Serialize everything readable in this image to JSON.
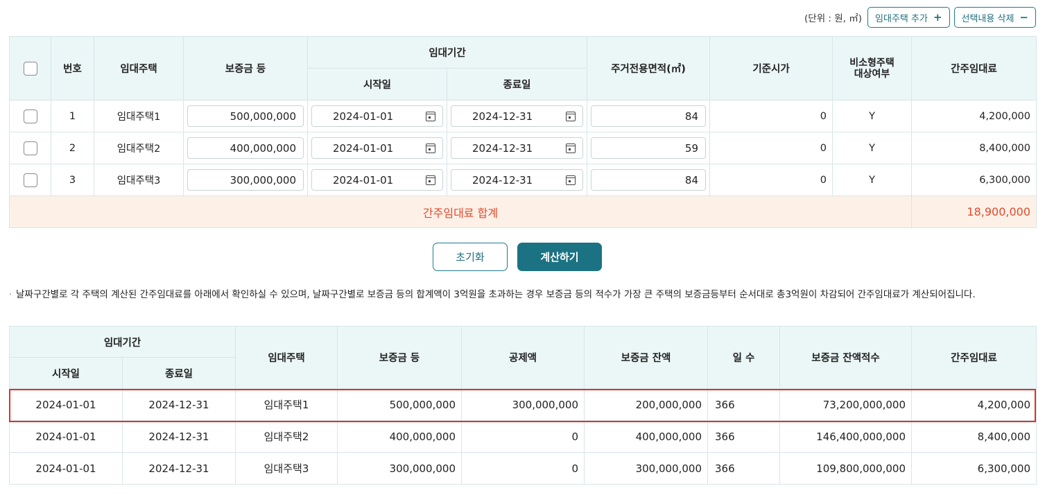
{
  "top": {
    "unit": "(단위 : 원, ㎡)",
    "add_button": "임대주택 추가",
    "add_symbol": "+",
    "delete_button": "선택내용 삭제",
    "delete_symbol": "−"
  },
  "table1": {
    "headers": {
      "number": "번호",
      "house": "임대주택",
      "deposit": "보증금 등",
      "period": "임대기간",
      "start": "시작일",
      "end": "종료일",
      "area": "주거전용면적(㎡)",
      "price": "기준시가",
      "small": "비소형주택\n대상여부",
      "rent": "간주임대료"
    },
    "rows": [
      {
        "no": "1",
        "house": "임대주택1",
        "deposit": "500,000,000",
        "start": "2024-01-01",
        "end": "2024-12-31",
        "area": "84",
        "price": "0",
        "small": "Y",
        "rent": "4,200,000"
      },
      {
        "no": "2",
        "house": "임대주택2",
        "deposit": "400,000,000",
        "start": "2024-01-01",
        "end": "2024-12-31",
        "area": "59",
        "price": "0",
        "small": "Y",
        "rent": "8,400,000"
      },
      {
        "no": "3",
        "house": "임대주택3",
        "deposit": "300,000,000",
        "start": "2024-01-01",
        "end": "2024-12-31",
        "area": "84",
        "price": "0",
        "small": "Y",
        "rent": "6,300,000"
      }
    ],
    "sum_label": "간주임대료 합계",
    "sum_value": "18,900,000"
  },
  "buttons": {
    "reset": "초기화",
    "calc": "계산하기"
  },
  "note": {
    "bullet": "·",
    "text": "날짜구간별로 각 주택의 계산된 간주임대료를 아래에서 확인하실 수 있으며, 날짜구간별로 보증금 등의 합계액이 3억원을 초과하는 경우 보증금 등의 적수가 가장 큰 주택의 보증금등부터 순서대로 총3억원이 차감되어 간주임대료가 계산되어집니다."
  },
  "table2": {
    "headers": {
      "period": "임대기간",
      "start": "시작일",
      "end": "종료일",
      "house": "임대주택",
      "deposit": "보증금 등",
      "deduction": "공제액",
      "balance": "보증금 잔액",
      "days": "일 수",
      "accum": "보증금 잔액적수",
      "rent": "간주임대료"
    },
    "rows": [
      {
        "start": "2024-01-01",
        "end": "2024-12-31",
        "house": "임대주택1",
        "deposit": "500,000,000",
        "deduction": "300,000,000",
        "balance": "200,000,000",
        "days": "366",
        "accum": "73,200,000,000",
        "rent": "4,200,000"
      },
      {
        "start": "2024-01-01",
        "end": "2024-12-31",
        "house": "임대주택2",
        "deposit": "400,000,000",
        "deduction": "0",
        "balance": "400,000,000",
        "days": "366",
        "accum": "146,400,000,000",
        "rent": "8,400,000"
      },
      {
        "start": "2024-01-01",
        "end": "2024-12-31",
        "house": "임대주택3",
        "deposit": "300,000,000",
        "deduction": "0",
        "balance": "300,000,000",
        "days": "366",
        "accum": "109,800,000,000",
        "rent": "6,300,000"
      }
    ]
  },
  "colors": {
    "accent": "#1b7282",
    "header_bg": "#ebf6f6",
    "sum_bg": "#fdf1e7",
    "sum_text": "#e24a2d",
    "highlight": "#e0302a"
  }
}
